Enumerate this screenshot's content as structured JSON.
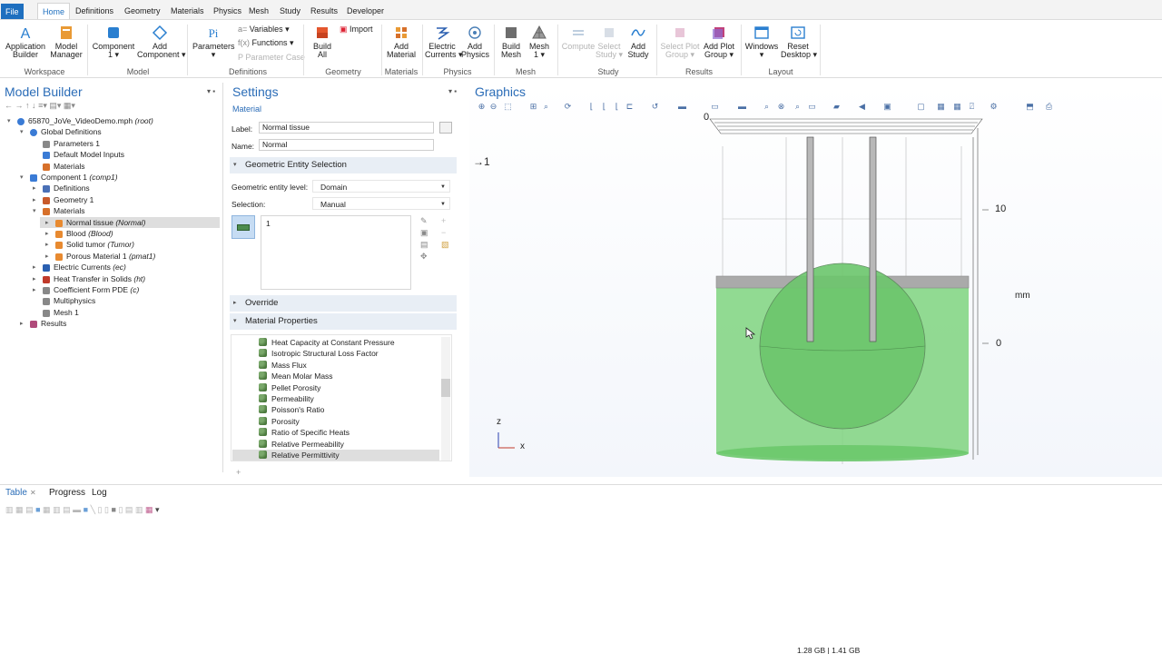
{
  "menu": {
    "tabs": [
      "File",
      "Home",
      "Definitions",
      "Geometry",
      "Materials",
      "Physics",
      "Mesh",
      "Study",
      "Results",
      "Developer"
    ],
    "active": "Home"
  },
  "ribbon": {
    "workspace": {
      "app_builder": [
        "Application",
        "Builder"
      ],
      "model_manager": [
        "Model",
        "Manager"
      ],
      "group": "Workspace"
    },
    "model": {
      "component": [
        "Component",
        "1 ▾"
      ],
      "add_component": [
        "Add",
        "Component ▾"
      ],
      "group": "Model"
    },
    "definitions": {
      "parameters": [
        "Parameters",
        "▾"
      ],
      "variables": "Variables ▾",
      "functions": "Functions ▾",
      "parameter_case": "Parameter Case",
      "group": "Definitions"
    },
    "geometry": {
      "build_all": [
        "Build",
        "All"
      ],
      "import": "Import",
      "group": "Geometry"
    },
    "materials": {
      "add_material": [
        "Add",
        "Material"
      ],
      "group": "Materials"
    },
    "physics": {
      "electric_currents": [
        "Electric",
        "Currents ▾"
      ],
      "add_physics": [
        "Add",
        "Physics"
      ],
      "group": "Physics"
    },
    "mesh": {
      "build_mesh": [
        "Build",
        "Mesh"
      ],
      "mesh1": [
        "Mesh",
        "1 ▾"
      ],
      "group": "Mesh"
    },
    "study": {
      "compute": "Compute",
      "select_study": [
        "Select",
        "Study ▾"
      ],
      "add_study": [
        "Add",
        "Study"
      ],
      "group": "Study"
    },
    "results": {
      "select_plot_group": [
        "Select Plot",
        "Group ▾"
      ],
      "add_plot_group": [
        "Add Plot",
        "Group ▾"
      ],
      "group": "Results"
    },
    "layout": {
      "windows": [
        "Windows",
        "▾"
      ],
      "reset_desktop": [
        "Reset",
        "Desktop ▾"
      ],
      "group": "Layout"
    }
  },
  "model_builder": {
    "title": "Model Builder",
    "tree": [
      {
        "label": "65870_JoVe_VideoDemo.mph",
        "tag": "(root)",
        "level": 0,
        "toggle": "▾",
        "icon": "root-icon"
      },
      {
        "label": "Global Definitions",
        "tag": "",
        "level": 1,
        "toggle": "▾",
        "icon": "globe-icon"
      },
      {
        "label": "Parameters 1",
        "tag": "",
        "level": 2,
        "toggle": "",
        "icon": "parameters-icon"
      },
      {
        "label": "Default Model Inputs",
        "tag": "",
        "level": 2,
        "toggle": "",
        "icon": "model-inputs-icon"
      },
      {
        "label": "Materials",
        "tag": "",
        "level": 2,
        "toggle": "",
        "icon": "materials-icon"
      },
      {
        "label": "Component 1",
        "tag": "(comp1)",
        "level": 1,
        "toggle": "▾",
        "icon": "component-icon"
      },
      {
        "label": "Definitions",
        "tag": "",
        "level": 2,
        "toggle": "▸",
        "icon": "definitions-icon"
      },
      {
        "label": "Geometry 1",
        "tag": "",
        "level": 2,
        "toggle": "▸",
        "icon": "geometry-icon"
      },
      {
        "label": "Materials",
        "tag": "",
        "level": 2,
        "toggle": "▾",
        "icon": "materials-icon"
      },
      {
        "label": "Normal tissue",
        "tag": "(Normal)",
        "level": 3,
        "toggle": "▸",
        "icon": "material-icon",
        "selected": true
      },
      {
        "label": "Blood",
        "tag": "(Blood)",
        "level": 3,
        "toggle": "▸",
        "icon": "material-icon"
      },
      {
        "label": "Solid tumor",
        "tag": "(Tumor)",
        "level": 3,
        "toggle": "▸",
        "icon": "material-icon"
      },
      {
        "label": "Porous Material 1",
        "tag": "(pmat1)",
        "level": 3,
        "toggle": "▸",
        "icon": "porous-material-icon"
      },
      {
        "label": "Electric Currents",
        "tag": "(ec)",
        "level": 2,
        "toggle": "▸",
        "icon": "electric-currents-icon"
      },
      {
        "label": "Heat Transfer in Solids",
        "tag": "(ht)",
        "level": 2,
        "toggle": "▸",
        "icon": "heat-transfer-icon"
      },
      {
        "label": "Coefficient Form PDE",
        "tag": "(c)",
        "level": 2,
        "toggle": "▸",
        "icon": "pde-icon"
      },
      {
        "label": "Multiphysics",
        "tag": "",
        "level": 2,
        "toggle": "",
        "icon": "multiphysics-icon"
      },
      {
        "label": "Mesh 1",
        "tag": "",
        "level": 2,
        "toggle": "",
        "icon": "mesh-icon"
      },
      {
        "label": "Results",
        "tag": "",
        "level": 1,
        "toggle": "▸",
        "icon": "results-icon"
      }
    ]
  },
  "settings": {
    "title": "Settings",
    "subtitle": "Material",
    "label_caption": "Label:",
    "label_value": "Normal tissue",
    "name_caption": "Name:",
    "name_value": "Normal",
    "geo_section": "Geometric Entity Selection",
    "entity_level_caption": "Geometric entity level:",
    "entity_level_value": "Domain",
    "selection_caption": "Selection:",
    "selection_value": "Manual",
    "selection_list_item": "1",
    "override_section": "Override",
    "matprop_section": "Material Properties",
    "properties": [
      "Heat Capacity at Constant Pressure",
      "Isotropic Structural Loss Factor",
      "Mass Flux",
      "Mean Molar Mass",
      "Pellet Porosity",
      "Permeability",
      "Poisson's Ratio",
      "Porosity",
      "Ratio of Specific Heats",
      "Relative Permeability",
      "Relative Permittivity"
    ],
    "selected_property": "Relative Permittivity"
  },
  "graphics": {
    "title": "Graphics",
    "label_arrow": "→1",
    "axis_top_zero": "0",
    "axis_ten": "10",
    "axis_unit": "mm",
    "axis_zero": "0",
    "triad_z": "z",
    "triad_x": "x",
    "material_color": "#7fd37f"
  },
  "bottom": {
    "tabs": [
      "Table",
      "Progress",
      "Log"
    ]
  },
  "status": {
    "memory": "1.28 GB | 1.41 GB"
  },
  "colors": {
    "accent": "#1e6fbf",
    "title_blue": "#2a6cb7"
  }
}
